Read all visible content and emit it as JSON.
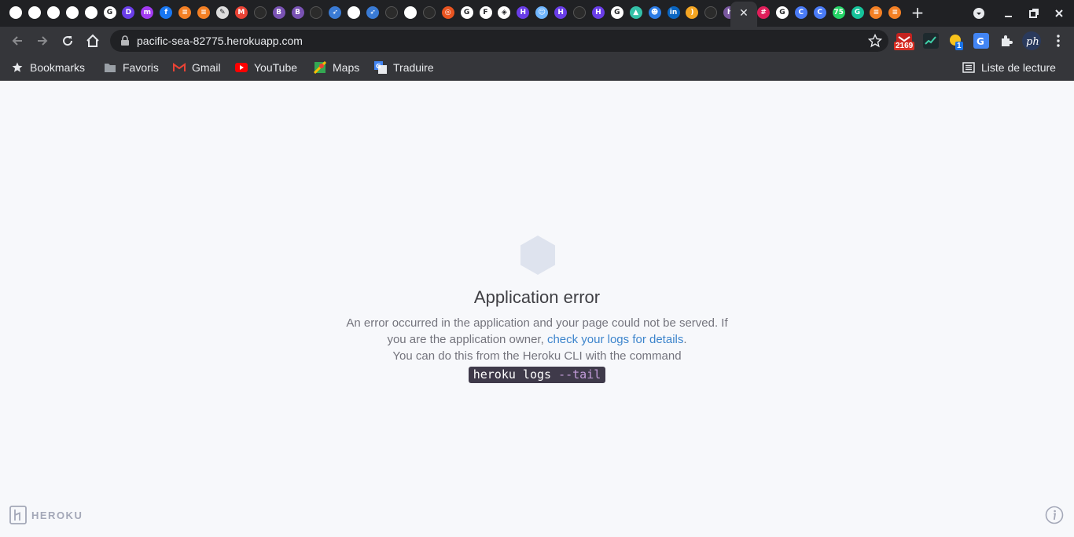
{
  "colors": {
    "tabstrip_bg": "#202124",
    "toolbar_bg": "#35363a",
    "page_bg": "#f7f8fb",
    "link": "#3c84cc",
    "command_bg": "#3f3a4a",
    "command_flag": "#c49ddb",
    "hexagon": "#dee3ee"
  },
  "tabs": {
    "favicons": [
      {
        "name": "globe-icon",
        "color": "#ffffff",
        "glyph": ""
      },
      {
        "name": "globe-icon",
        "color": "#ffffff",
        "glyph": ""
      },
      {
        "name": "globe-icon",
        "color": "#ffffff",
        "glyph": ""
      },
      {
        "name": "globe-icon",
        "color": "#ffffff",
        "glyph": ""
      },
      {
        "name": "globe-icon",
        "color": "#ffffff",
        "glyph": ""
      },
      {
        "name": "google-icon",
        "color": "#ffffff",
        "glyph": "G"
      },
      {
        "name": "d-app-icon",
        "color": "#6a3de8",
        "glyph": "D"
      },
      {
        "name": "messenger-icon",
        "color": "#a33bf2",
        "glyph": "m"
      },
      {
        "name": "facebook-icon",
        "color": "#1877f2",
        "glyph": "f"
      },
      {
        "name": "stackoverflow-icon",
        "color": "#f48024",
        "glyph": "≡"
      },
      {
        "name": "stackoverflow-icon",
        "color": "#f48024",
        "glyph": "≡"
      },
      {
        "name": "pen-icon",
        "color": "#dddddd",
        "glyph": "✎"
      },
      {
        "name": "gmail-icon",
        "color": "#ea4335",
        "glyph": "M"
      },
      {
        "name": "github-icon",
        "color": "#2b2b2b",
        "glyph": ""
      },
      {
        "name": "bootstrap-icon",
        "color": "#7952b3",
        "glyph": "B"
      },
      {
        "name": "bootstrap-icon",
        "color": "#7952b3",
        "glyph": "B"
      },
      {
        "name": "github-icon",
        "color": "#2b2b2b",
        "glyph": ""
      },
      {
        "name": "rocket-icon",
        "color": "#3a7bd5",
        "glyph": "➶"
      },
      {
        "name": "globe-icon",
        "color": "#ffffff",
        "glyph": ""
      },
      {
        "name": "rocket-icon",
        "color": "#3a7bd5",
        "glyph": "➶"
      },
      {
        "name": "github-icon",
        "color": "#2b2b2b",
        "glyph": ""
      },
      {
        "name": "globe-icon",
        "color": "#ffffff",
        "glyph": ""
      },
      {
        "name": "github-icon",
        "color": "#2b2b2b",
        "glyph": ""
      },
      {
        "name": "ubuntu-icon",
        "color": "#e95420",
        "glyph": "◎"
      },
      {
        "name": "google-icon",
        "color": "#ffffff",
        "glyph": "G"
      },
      {
        "name": "f-icon",
        "color": "#ffffff",
        "glyph": "F"
      },
      {
        "name": "codepen-icon",
        "color": "#ffffff",
        "glyph": "◈"
      },
      {
        "name": "hackerrank-icon",
        "color": "#6a3de8",
        "glyph": "H"
      },
      {
        "name": "robot-icon",
        "color": "#6fb6ff",
        "glyph": "☺"
      },
      {
        "name": "hackerrank-icon",
        "color": "#6a3de8",
        "glyph": "H"
      },
      {
        "name": "github-icon",
        "color": "#2b2b2b",
        "glyph": ""
      },
      {
        "name": "hackerrank-icon",
        "color": "#6a3de8",
        "glyph": "H"
      },
      {
        "name": "google-icon",
        "color": "#ffffff",
        "glyph": "G"
      },
      {
        "name": "mountain-icon",
        "color": "#34c1a8",
        "glyph": "▲"
      },
      {
        "name": "robot-icon",
        "color": "#2b7be4",
        "glyph": "☻"
      },
      {
        "name": "linkedin-icon",
        "color": "#0a66c2",
        "glyph": "in"
      },
      {
        "name": "banana-icon",
        "color": "#f5a623",
        "glyph": ")"
      },
      {
        "name": "github-icon",
        "color": "#2b2b2b",
        "glyph": ""
      },
      {
        "name": "heroku-icon",
        "color": "#79589f",
        "glyph": "h"
      }
    ],
    "favicons_after_active": [
      {
        "name": "slack-icon",
        "color": "#e01e5a",
        "glyph": "#"
      },
      {
        "name": "google-icon",
        "color": "#ffffff",
        "glyph": "G"
      },
      {
        "name": "c-icon",
        "color": "#4a7bf7",
        "glyph": "C"
      },
      {
        "name": "c-icon",
        "color": "#4a7bf7",
        "glyph": "C"
      },
      {
        "name": "whatsapp-icon",
        "color": "#25d366",
        "glyph": "75"
      },
      {
        "name": "grammarly-icon",
        "color": "#15c39a",
        "glyph": "G"
      },
      {
        "name": "stackoverflow-icon",
        "color": "#f48024",
        "glyph": "≡"
      },
      {
        "name": "stackoverflow-icon",
        "color": "#f48024",
        "glyph": "≡"
      }
    ]
  },
  "toolbar": {
    "url": "pacific-sea-82775.herokuapp.com",
    "mail_badge": "2169",
    "extension_badge": "1"
  },
  "bookmarks": {
    "items": [
      {
        "label": "Bookmarks",
        "icon": "star-icon"
      },
      {
        "label": "Favoris",
        "icon": "folder-icon"
      },
      {
        "label": "Gmail",
        "icon": "gmail-icon"
      },
      {
        "label": "YouTube",
        "icon": "youtube-icon"
      },
      {
        "label": "Maps",
        "icon": "maps-icon"
      },
      {
        "label": "Traduire",
        "icon": "translate-icon"
      }
    ],
    "reading_list": "Liste de lecture"
  },
  "page": {
    "title": "Application error",
    "body_line1": "An error occurred in the application and your page could not be served. If you are the application owner,",
    "link_text": "check your logs for details",
    "body_line2": "You can do this from the Heroku CLI with the command",
    "command_main": "heroku logs ",
    "command_flag": "--tail",
    "footer_logo": "HEROKU"
  }
}
